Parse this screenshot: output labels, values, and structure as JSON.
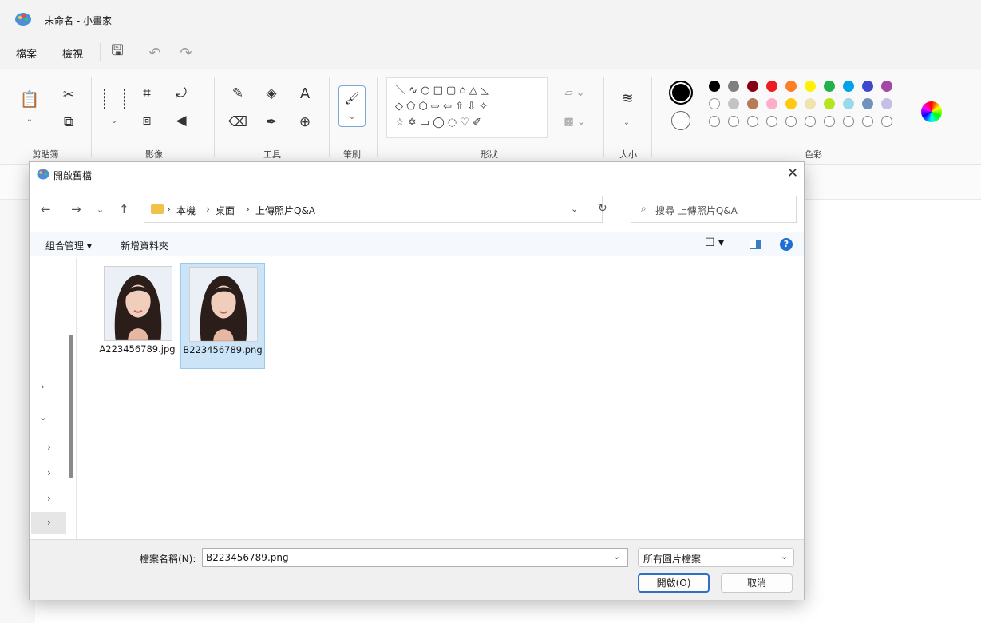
{
  "app": {
    "title": "未命名 - 小畫家"
  },
  "menu": {
    "file": "檔案",
    "view": "檢視"
  },
  "ribbon": {
    "groups": {
      "clipboard": "剪貼簿",
      "image": "影像",
      "tools": "工具",
      "brushes": "筆刷",
      "shapes": "形狀",
      "size": "大小",
      "colors": "色彩"
    },
    "tool_text": "A",
    "shapes_glyphs": [
      "＼ ∿ ○ □ ▢ ⌂ △ ◺",
      "◇ ⬠ ⬡ ⇨ ⇦ ⇧ ⇩ ✧",
      "☆ ✡ ▭ ◯ ◌ ♡ ✐"
    ],
    "palette_row1": [
      "#000000",
      "#7f7f7f",
      "#880015",
      "#ed1c24",
      "#ff7f27",
      "#fff200",
      "#22b14c",
      "#00a2e8",
      "#3f48cc",
      "#a349a4"
    ],
    "palette_row2": [
      "#ffffff",
      "#c3c3c3",
      "#b97a57",
      "#ffaec9",
      "#ffc90e",
      "#efe4b0",
      "#b5e61d",
      "#99d9ea",
      "#7092be",
      "#c8bfe7"
    ]
  },
  "dialog": {
    "title": "開啟舊檔",
    "breadcrumb": [
      "本機",
      "桌面",
      "上傳照片Q&A"
    ],
    "search_placeholder": "搜尋 上傳照片Q&A",
    "organize": "組合管理 ▾",
    "new_folder": "新增資料夾",
    "files": [
      {
        "name": "A223456789.jpg",
        "selected": false
      },
      {
        "name": "B223456789.png",
        "selected": true
      }
    ],
    "filename_label": "檔案名稱(N):",
    "filename_value": "B223456789.png",
    "filetype": "所有圖片檔案",
    "open_button": "開啟(O)",
    "cancel_button": "取消"
  }
}
